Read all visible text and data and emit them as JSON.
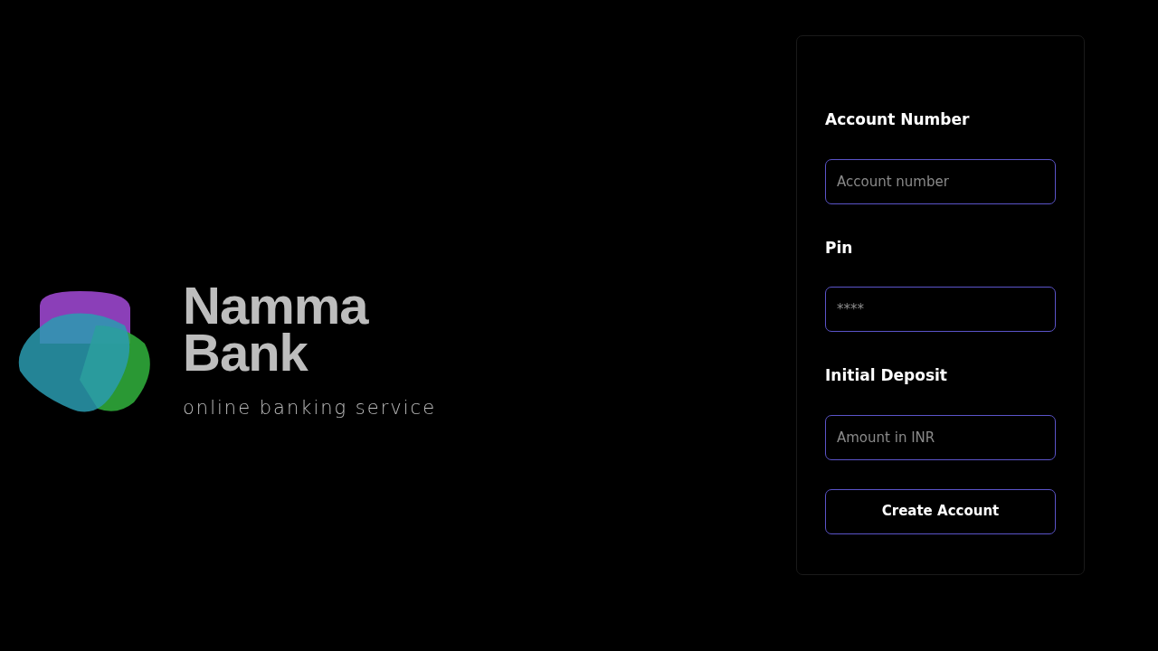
{
  "brand": {
    "name_line_1": "Namma",
    "name_line_2": "Bank",
    "tagline": "online banking service"
  },
  "form": {
    "fields": [
      {
        "label": "Account Number",
        "placeholder": "Account number"
      },
      {
        "label": "Pin",
        "placeholder": "****"
      },
      {
        "label": "Initial Deposit",
        "placeholder": "Amount in INR"
      }
    ],
    "submit": "Create Account"
  }
}
